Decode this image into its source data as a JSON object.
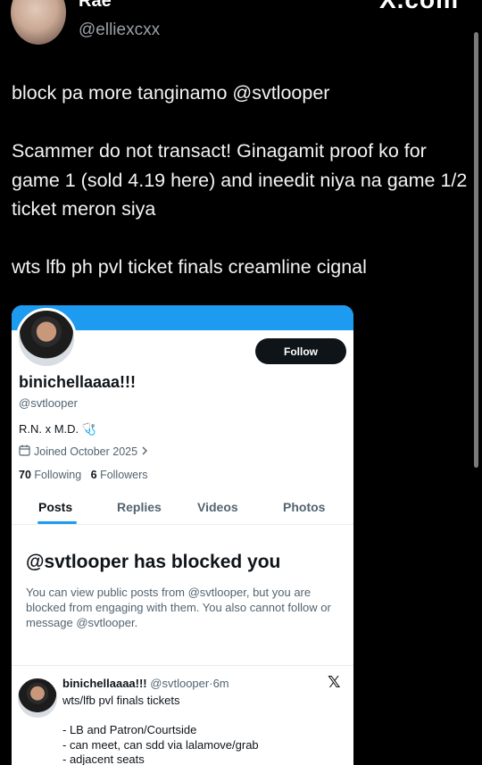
{
  "header": {
    "name": "Rae",
    "handle": "@elliexcxx",
    "brand": "X.com"
  },
  "tweet": {
    "paragraphs": [
      "block pa more tanginamo @svtlooper",
      "Scammer do not transact! Ginagamit proof ko for game 1 (sold 4.19 here) and ineedit niya na game 1/2 ticket meron siya",
      "wts lfb ph pvl ticket finals creamline cignal"
    ]
  },
  "card": {
    "follow_label": "Follow",
    "name": "binichellaaaa!!!",
    "handle": "@svtlooper",
    "bio": "R.N. x M.D. 🩺",
    "joined": "Joined October 2025",
    "following_count": "70",
    "following_label": "Following",
    "followers_count": "6",
    "followers_label": "Followers",
    "tabs": [
      "Posts",
      "Replies",
      "Videos",
      "Photos"
    ],
    "blocked_title": "@svtlooper has blocked you",
    "blocked_desc": "You can view public posts from @svtlooper, but you are blocked from engaging with them. You also cannot follow or message @svtlooper.",
    "post": {
      "name": "binichellaaaa!!!",
      "handle": "@svtlooper",
      "time": "6m",
      "lines": [
        "wts/lfb pvl finals tickets",
        "",
        "- LB and Patron/Courtside",
        "- can meet, can sdd via lalamove/grab",
        "- adjacent seats"
      ]
    }
  },
  "colors": {
    "banner": "#1d9bf0",
    "accent": "#1d9bf0",
    "background": "#000000"
  }
}
